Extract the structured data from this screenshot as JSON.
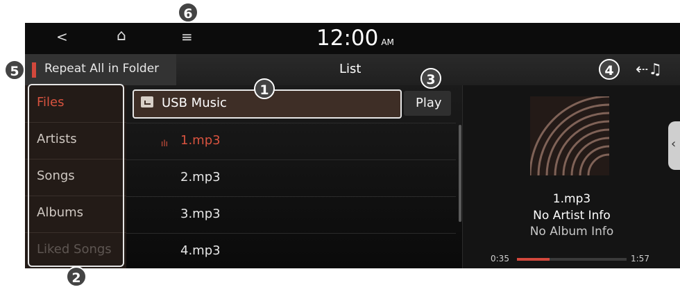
{
  "status_bar": {
    "back_glyph": "<",
    "home_glyph": "⌂",
    "menu_glyph": "≡",
    "time": "12:00",
    "ampm": "AM"
  },
  "header": {
    "repeat_label": "Repeat All in Folder",
    "title": "List",
    "back_to_player_glyph": "⇠♫"
  },
  "sidebar": {
    "items": [
      {
        "label": "Files",
        "state": "active"
      },
      {
        "label": "Artists",
        "state": "normal"
      },
      {
        "label": "Songs",
        "state": "normal"
      },
      {
        "label": "Albums",
        "state": "normal"
      },
      {
        "label": "Liked Songs",
        "state": "disabled"
      }
    ]
  },
  "list": {
    "folder_label": "USB Music",
    "play_label": "Play",
    "tracks": [
      "1.mp3",
      "2.mp3",
      "3.mp3",
      "4.mp3"
    ],
    "playing_index": 0,
    "eq_glyph": "ılı"
  },
  "now_playing": {
    "title": "1.mp3",
    "artist": "No Artist Info",
    "album": "No Album Info",
    "elapsed": "0:35",
    "total": "1:57",
    "progress": 0.3,
    "tab_glyph": "‹"
  },
  "callouts": [
    "1",
    "2",
    "3",
    "4",
    "5",
    "6"
  ],
  "colors": {
    "accent": "#d8533f",
    "background": "#141414",
    "folder_bg": "#3e2e26"
  }
}
